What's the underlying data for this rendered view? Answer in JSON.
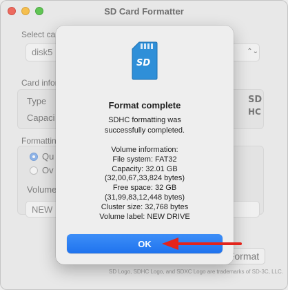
{
  "window": {
    "title": "SD Card Formatter"
  },
  "background": {
    "select_card_label": "Select ca",
    "card_value": "disk5",
    "card_info_label": "Card infor",
    "type_label": "Type",
    "capacity_label": "Capaci",
    "formatting_label": "Formattin",
    "quick_label": "Qu",
    "overwrite_label": "Ov",
    "volume_label": "Volume",
    "volume_value": "NEW D",
    "format_button": "Format",
    "trademark": "SD Logo, SDHC Logo, and SDXC Logo are trademarks of SD-3C, LLC."
  },
  "dialog": {
    "icon": "sd-card-icon",
    "title": "Format complete",
    "message": "SDHC formatting was\nsuccessfully completed.",
    "info": "Volume information:\nFile system: FAT32\nCapacity: 32.01 GB\n(32,00,67,33,824 bytes)\nFree space: 32 GB\n(31,99,83,12,448 bytes)\nCluster size: 32,768 bytes\nVolume label: NEW DRIVE",
    "ok_label": "OK"
  },
  "colors": {
    "accent": "#1f73ee",
    "arrow": "#e3241b"
  }
}
